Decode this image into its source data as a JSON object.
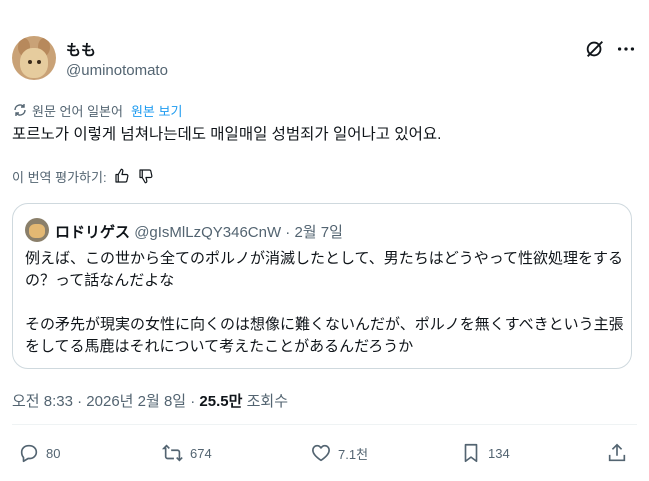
{
  "author": {
    "display_name": "もも",
    "handle": "@uminotomato"
  },
  "translation": {
    "notice": "원문 언어 일본어",
    "show_original": "원본 보기"
  },
  "tweet": {
    "text": "포르노가 이렇게 넘쳐나는데도 매일매일 성범죄가 일어나고 있어요."
  },
  "rate_translation": {
    "label": "이 번역 평가하기:"
  },
  "quoted_tweet": {
    "display_name": "ロドリゲス",
    "handle_date": "@gIsMlLzQY346CnW · 2월 7일",
    "paragraph1": "例えば、この世から全てのポルノが消滅したとして、男たちはどうやって性欲処理をするの？って話なんだよな",
    "paragraph2": "その矛先が現実の女性に向くのは想像に難くないんだが、ポルノを無くすべきという主張をしてる馬鹿はそれについて考えたことがあるんだろうか"
  },
  "meta": {
    "datetime": "오전 8:33 · 2026년 2월 8일 · ",
    "views": "25.5만",
    "views_label": " 조회수"
  },
  "actions": {
    "replies": "80",
    "retweets": "674",
    "likes": "7.1천",
    "bookmarks": "134"
  },
  "colors": {
    "text": "#0f1419",
    "secondary": "#536471",
    "link": "#1d9bf0",
    "border": "#cfd9de"
  }
}
